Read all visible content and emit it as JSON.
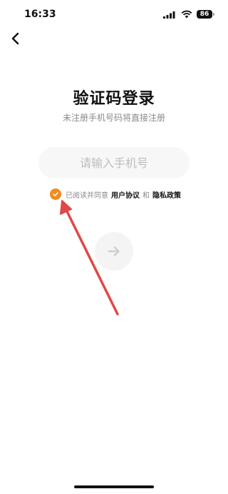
{
  "status_bar": {
    "time": "16:33",
    "battery_level": "86"
  },
  "header": {
    "back_icon": "chevron-left-icon"
  },
  "login": {
    "title": "验证码登录",
    "subtitle": "未注册手机号码将直接注册",
    "phone_placeholder": "请输入手机号",
    "phone_value": ""
  },
  "agreement": {
    "checked": true,
    "prefix": "已阅读并同意",
    "user_agreement": "用户协议",
    "conjunction": "和",
    "privacy_policy": "隐私政策"
  },
  "next_button": {
    "icon": "arrow-right-icon"
  },
  "annotation": {
    "type": "arrow",
    "color": "#e04848"
  },
  "colors": {
    "accent": "#f28a1e",
    "input_bg": "#f7f7f7",
    "muted_text": "#8a8a8a"
  }
}
